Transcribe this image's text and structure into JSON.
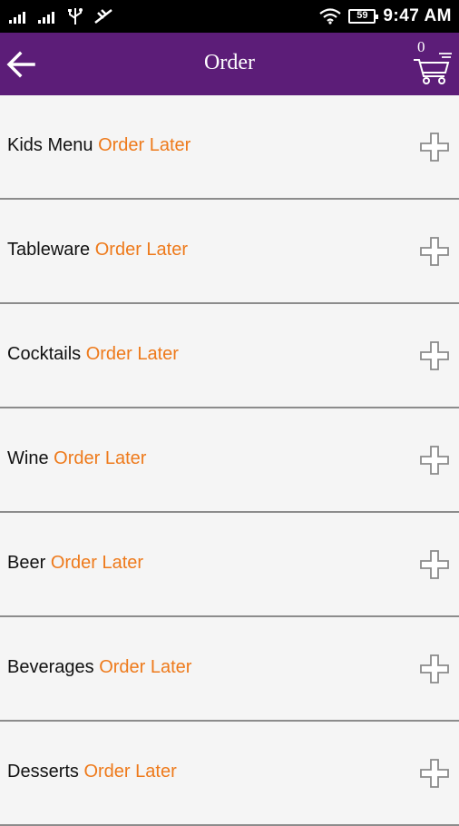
{
  "status_bar": {
    "time": "9:47 AM",
    "battery": "59"
  },
  "app_bar": {
    "title": "Order",
    "cart_count": "0"
  },
  "items": [
    {
      "name": "Kids Menu",
      "status": "Order Later"
    },
    {
      "name": "Tableware",
      "status": "Order Later"
    },
    {
      "name": "Cocktails",
      "status": "Order Later"
    },
    {
      "name": "Wine",
      "status": "Order Later"
    },
    {
      "name": "Beer",
      "status": "Order Later"
    },
    {
      "name": "Beverages",
      "status": "Order Later"
    },
    {
      "name": "Desserts",
      "status": "Order Later"
    }
  ],
  "colors": {
    "app_bar": "#5c1d78",
    "accent": "#ee7a1b",
    "background": "#f5f5f5"
  },
  "icons": {
    "back": "arrow-left-icon",
    "cart": "cart-icon",
    "add": "plus-icon"
  }
}
